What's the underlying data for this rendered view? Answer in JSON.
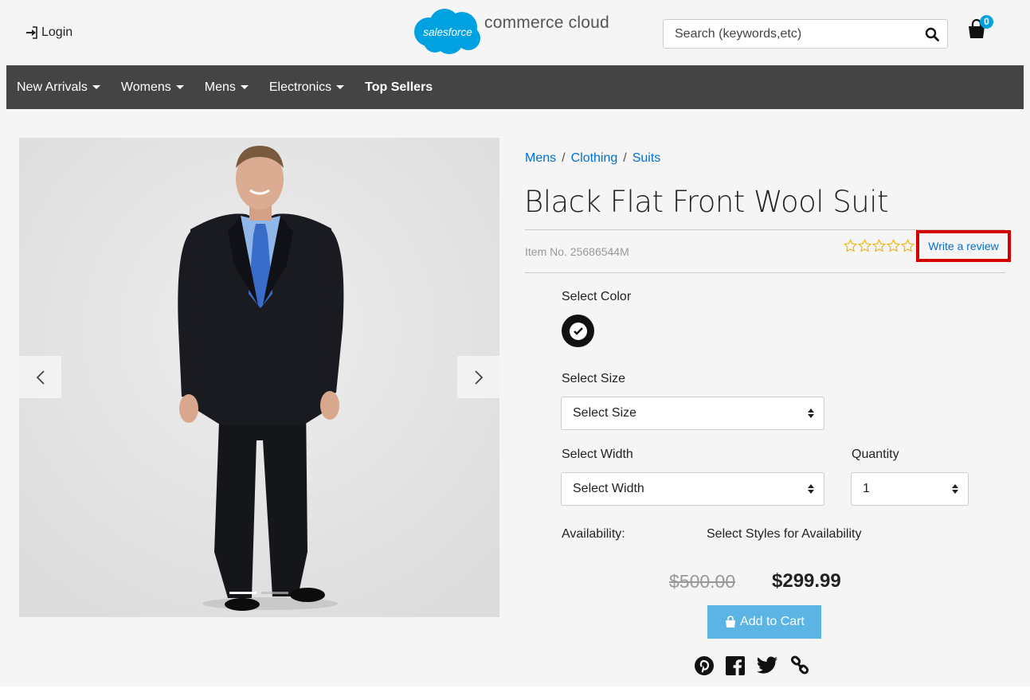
{
  "header": {
    "login_label": "Login",
    "logo_badge": "salesforce",
    "logo_text": "commerce cloud",
    "search_placeholder": "Search (keywords,etc)",
    "cart_count": "0"
  },
  "nav": {
    "items": [
      {
        "label": "New Arrivals",
        "dropdown": true
      },
      {
        "label": "Womens",
        "dropdown": true
      },
      {
        "label": "Mens",
        "dropdown": true
      },
      {
        "label": "Electronics",
        "dropdown": true
      },
      {
        "label": "Top Sellers",
        "dropdown": false
      }
    ]
  },
  "breadcrumb": [
    "Mens",
    "Clothing",
    "Suits"
  ],
  "product": {
    "title": "Black Flat Front Wool Suit",
    "item_no": "Item No. 25686544M",
    "rating": 0,
    "rating_max": 5,
    "review_link": "Write a review",
    "color_label": "Select Color",
    "size_label": "Select Size",
    "size_value": "Select Size",
    "width_label": "Select Width",
    "width_value": "Select Width",
    "quantity_label": "Quantity",
    "quantity_value": "1",
    "availability_label": "Availability:",
    "availability_value": "Select Styles for Availability",
    "old_price": "$500.00",
    "new_price": "$299.99",
    "add_to_cart": "Add to Cart"
  },
  "colors": {
    "accent": "#0070d2",
    "nav_bg": "#444444",
    "button_bg": "#5bb4e4",
    "highlight_box": "#d40000",
    "star": "#f0b400"
  }
}
